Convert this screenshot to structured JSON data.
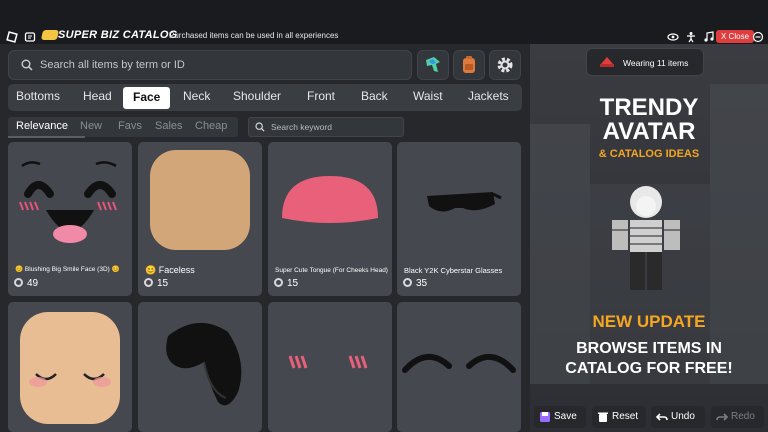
{
  "app": {
    "title": "SUPER BIZ CATALOG",
    "subtitle": "Purchased items can be used in all experiences",
    "close_label": "X Close"
  },
  "search": {
    "placeholder": "Search all items by term or ID"
  },
  "categories": [
    "Bottoms",
    "Head",
    "Face",
    "Neck",
    "Shoulder",
    "Front",
    "Back",
    "Waist",
    "Jackets"
  ],
  "active_category": "Face",
  "sorts": [
    "Relevance",
    "New",
    "Favs",
    "Sales",
    "Cheap"
  ],
  "active_sort": "Relevance",
  "keyword": {
    "placeholder": "Search keyword"
  },
  "items": [
    {
      "name": "Blushing Big Smile Face (3D)",
      "price": "49"
    },
    {
      "name": "Faceless",
      "price": "15"
    },
    {
      "name": "Super Cute Tongue (For Cheeks Head)",
      "price": "15"
    },
    {
      "name": "Black Y2K Cyberstar Glasses",
      "price": "35"
    }
  ],
  "preview": {
    "wearing": "Wearing 11 items",
    "promo_title_1": "TRENDY",
    "promo_title_2": "AVATAR",
    "promo_sub": "& CATALOG IDEAS",
    "update": "NEW UPDATE",
    "browse_1": "BROWSE ITEMS IN",
    "browse_2": "CATALOG FOR FREE!"
  },
  "actions": {
    "save": "Save",
    "reset": "Reset",
    "undo": "Undo",
    "redo": "Redo"
  },
  "colors": {
    "accent_orange": "#f5a623",
    "close_red": "#e03e3e",
    "panel": "#26282c"
  }
}
